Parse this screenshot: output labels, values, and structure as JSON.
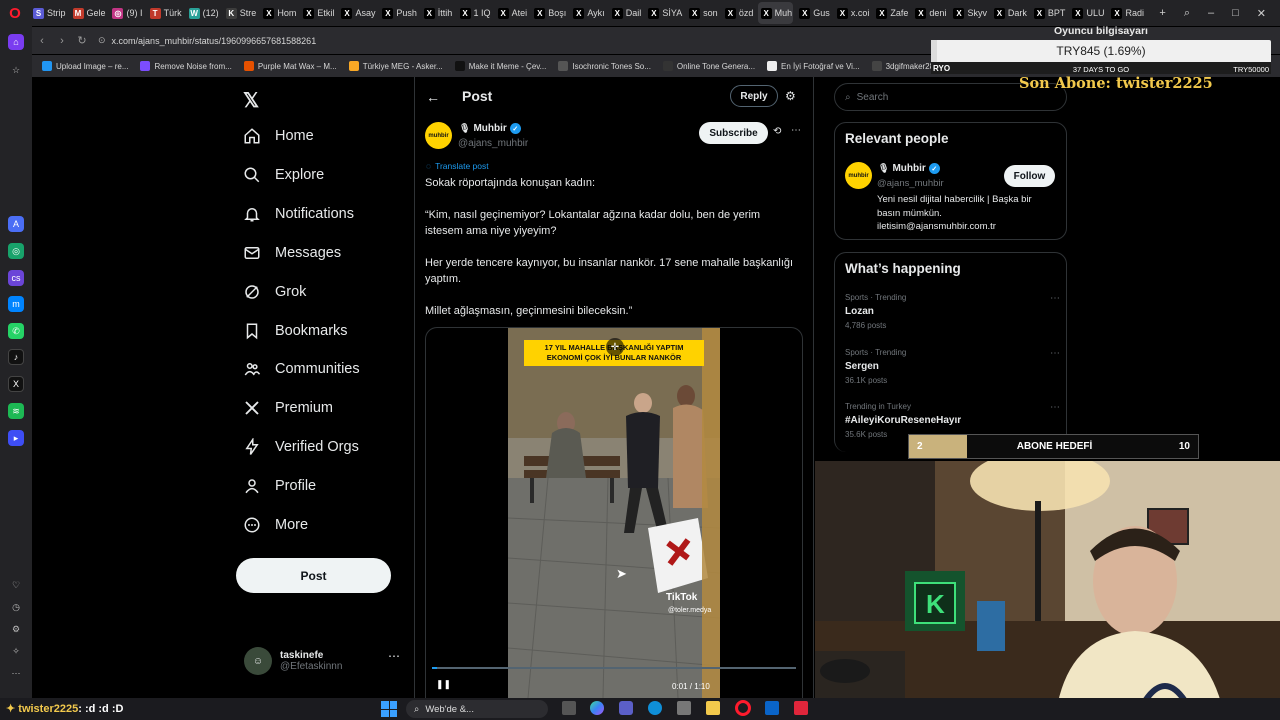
{
  "browser": {
    "tabs": [
      {
        "label": "Strip",
        "color": "#5b5bd6",
        "icon": "S"
      },
      {
        "label": "Gele",
        "color": "#c23b2c",
        "icon": "M"
      },
      {
        "label": "(9) I",
        "color": "#c13584",
        "icon": "◎"
      },
      {
        "label": "Türk",
        "color": "#c0392b",
        "icon": "T"
      },
      {
        "label": "(12)",
        "color": "#2aa198",
        "icon": "W"
      },
      {
        "label": "Stre",
        "color": "#3c3c3c",
        "icon": "K"
      },
      {
        "label": "Hom",
        "color": "#000000",
        "icon": "X"
      },
      {
        "label": "Etkil",
        "color": "#000000",
        "icon": "X"
      },
      {
        "label": "Asay",
        "color": "#000000",
        "icon": "X"
      },
      {
        "label": "Push",
        "color": "#000000",
        "icon": "X"
      },
      {
        "label": "İttih",
        "color": "#000000",
        "icon": "X"
      },
      {
        "label": "1 IQ",
        "color": "#000000",
        "icon": "X"
      },
      {
        "label": "Atei",
        "color": "#000000",
        "icon": "X"
      },
      {
        "label": "Boşı",
        "color": "#000000",
        "icon": "X"
      },
      {
        "label": "Aykı",
        "color": "#000000",
        "icon": "X"
      },
      {
        "label": "Dail",
        "color": "#000000",
        "icon": "X"
      },
      {
        "label": "SİYA",
        "color": "#000000",
        "icon": "X"
      },
      {
        "label": "son",
        "color": "#000000",
        "icon": "X"
      },
      {
        "label": "özd",
        "color": "#000000",
        "icon": "X"
      },
      {
        "label": "Muh",
        "color": "#000000",
        "icon": "X"
      },
      {
        "label": "Gus",
        "color": "#000000",
        "icon": "X"
      },
      {
        "label": "x.coi",
        "color": "#000000",
        "icon": "X"
      },
      {
        "label": "Zafe",
        "color": "#000000",
        "icon": "X"
      },
      {
        "label": "deni",
        "color": "#000000",
        "icon": "X"
      },
      {
        "label": "Skyv",
        "color": "#000000",
        "icon": "X"
      },
      {
        "label": "Dark",
        "color": "#000000",
        "icon": "X"
      },
      {
        "label": "BPT",
        "color": "#000000",
        "icon": "X"
      },
      {
        "label": "ULU",
        "color": "#000000",
        "icon": "X"
      },
      {
        "label": "Radi",
        "color": "#000000",
        "icon": "X"
      }
    ],
    "url": "x.com/ajans_muhbir/status/1960996657681588261",
    "bookmarks": [
      {
        "label": "Upload Image – re...",
        "color": "#2196f3"
      },
      {
        "label": "Remove Noise from...",
        "color": "#7c4dff"
      },
      {
        "label": "Purple Mat Wax – M...",
        "color": "#e65100"
      },
      {
        "label": "Türkiye MEG - Asker...",
        "color": "#f9a825"
      },
      {
        "label": "Make it Meme - Çev...",
        "color": "#111111"
      },
      {
        "label": "Isochronic Tones So...",
        "color": "#555555"
      },
      {
        "label": "Online Tone Genera...",
        "color": "#333333"
      },
      {
        "label": "En İyi Fotoğraf ve Vi...",
        "color": "#eeeeee"
      },
      {
        "label": "3dgifmaker28349.gi...",
        "color": "#444444"
      }
    ]
  },
  "x": {
    "nav": [
      {
        "label": "Home",
        "icon": "home-icon"
      },
      {
        "label": "Explore",
        "icon": "search-icon"
      },
      {
        "label": "Notifications",
        "icon": "bell-icon"
      },
      {
        "label": "Messages",
        "icon": "mail-icon"
      },
      {
        "label": "Grok",
        "icon": "grok-icon"
      },
      {
        "label": "Bookmarks",
        "icon": "bookmark-icon"
      },
      {
        "label": "Communities",
        "icon": "people-icon"
      },
      {
        "label": "Premium",
        "icon": "x-logo-icon"
      },
      {
        "label": "Verified Orgs",
        "icon": "lightning-icon"
      },
      {
        "label": "Profile",
        "icon": "person-icon"
      },
      {
        "label": "More",
        "icon": "more-circle-icon"
      }
    ],
    "post_button": "Post",
    "account": {
      "name": "taskinefe",
      "handle": "@Efetaskinnn"
    },
    "header": {
      "title": "Post",
      "reply": "Reply"
    },
    "tweet": {
      "author": "Muhbir",
      "handle": "@ajans_muhbir",
      "avatar_text": "muhbir",
      "subscribe": "Subscribe",
      "translate": "Translate post",
      "paragraphs": [
        "Sokak röportajında konuşan kadın:",
        "“Kim, nasıl geçinemiyor? Lokantalar ağzına kadar dolu, ben de yerim istesem ama niye yiyeyim?",
        "Her yerde tencere kaynıyor, bu insanlar nankör. 17 sene mahalle başkanlığı yaptım.",
        "Millet ağlaşmasın, geçinmesini bileceksin.”"
      ],
      "video_caption": "17 YIL MAHALLE BAŞKANLIĞI YAPTIM EKONOMİ ÇOK İYİ BUNLAR NANKÖR",
      "tiktok": "TikTok",
      "tiktok_user": "@toler.medya",
      "time": "0:01 / 1:10"
    },
    "search_placeholder": "Search",
    "relevant": {
      "title": "Relevant people",
      "name": "Muhbir",
      "handle": "@ajans_muhbir",
      "follow": "Follow",
      "bio": "Yeni nesil dijital habercilik | Başka bir basın mümkün. iletisim@ajansmuhbir.com.tr"
    },
    "happening": {
      "title": "What’s happening",
      "trends": [
        {
          "cat": "Sports · Trending",
          "name": "Lozan",
          "count": "4,786 posts"
        },
        {
          "cat": "Sports · Trending",
          "name": "Sergen",
          "count": "36.1K posts"
        },
        {
          "cat": "Trending in Turkey",
          "name": "#AileyiKoruReseneHayır",
          "count": "35.6K posts"
        }
      ]
    }
  },
  "stream": {
    "ticker_label": "Oyuncu bilgisayarı",
    "ticker_value": "TRY845 (1.69%)",
    "ticker_left": "RYO",
    "ticker_mid": "37 DAYS TO GO",
    "ticker_right": "TRY50000",
    "ticker_fill_pct": 1.69,
    "last_sub": "Son Abone: twister2225",
    "goal_label": "ABONE HEDEFİ",
    "goal_current": "2",
    "goal_target": "10",
    "goal_fill_pct": 20,
    "chat_user": "twister2225",
    "chat_msg": ": :d :d :D"
  },
  "taskbar": {
    "search_label": "Web'de &..."
  },
  "colors": {
    "accent": "#1d9bf0",
    "verified": "#1d9bf0",
    "brand_yellow": "#ffd200",
    "goal": "#c9b27c"
  }
}
